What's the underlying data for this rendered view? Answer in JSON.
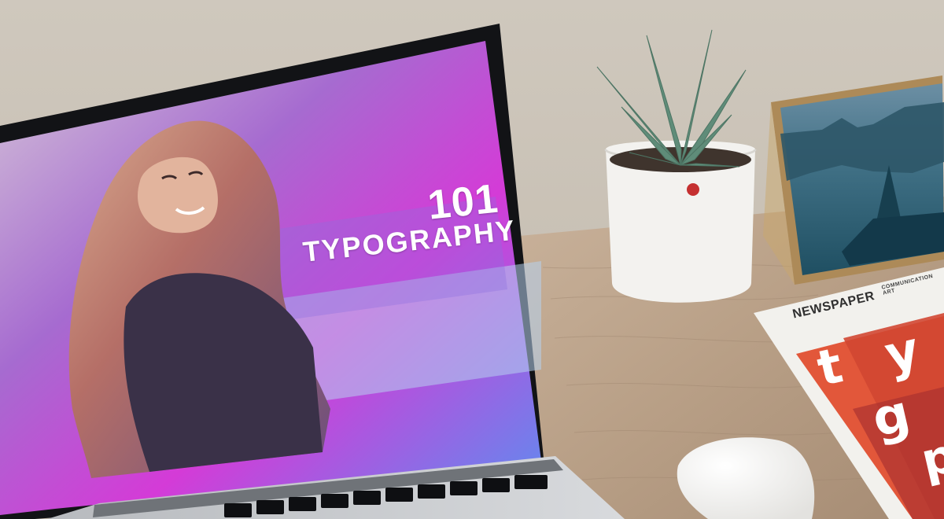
{
  "screen": {
    "hero_number": "101",
    "hero_word": "TYPOGRAPHY"
  },
  "newspaper": {
    "title": "NEWSPAPER",
    "subtitle": "COMMUNICATION ART",
    "letters": [
      "t",
      "y",
      "g",
      "p"
    ]
  },
  "colors": {
    "wall": "#c9c1b6",
    "desk_wood": "#b79f86",
    "laptop_silver": "#c8cbcf",
    "screen_bezel": "#121316",
    "screen_magenta": "#d43bd7",
    "screen_blue": "#4a8cf0",
    "newspaper_red": "#e2573a",
    "pot_white": "#f3f2ef",
    "succulent_green": "#5f8c79"
  },
  "icons": [
    "laptop-icon",
    "succulent-plant-icon",
    "photo-frame-icon",
    "newspaper-icon",
    "mouse-icon"
  ]
}
